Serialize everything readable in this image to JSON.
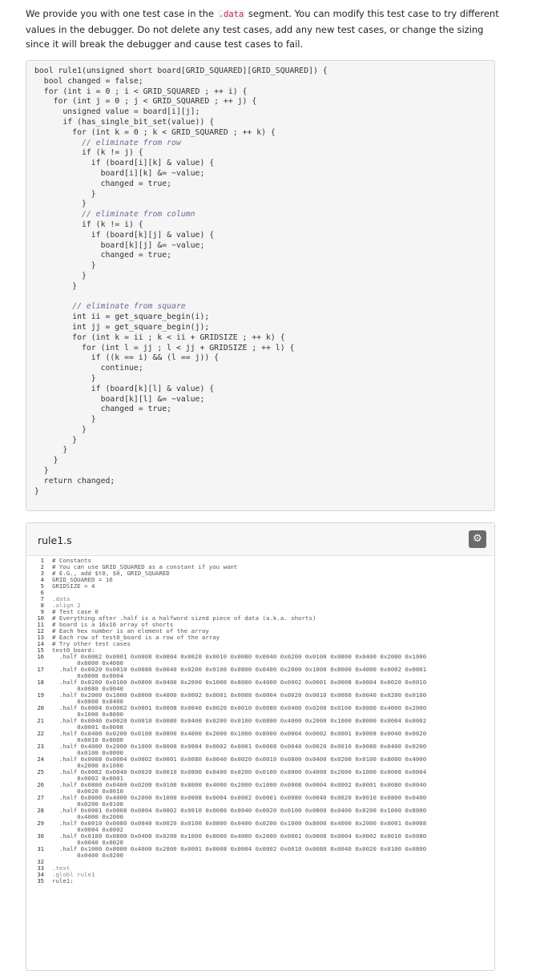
{
  "intro": {
    "before": "We provide you with one test case in the ",
    "data_word": ".data",
    "after": " segment. You can modify this test case to try different values in the debugger. Do not delete any test cases, add any new test cases, or change the sizing since it will break the debugger and cause test cases to fail."
  },
  "c_code": [
    "bool rule1(unsigned short board[GRID_SQUARED][GRID_SQUARED]) {",
    "  bool changed = false;",
    "  for (int i = 0 ; i < GRID_SQUARED ; ++ i) {",
    "    for (int j = 0 ; j < GRID_SQUARED ; ++ j) {",
    "      unsigned value = board[i][j];",
    "      if (has_single_bit_set(value)) {",
    "        for (int k = 0 ; k < GRID_SQUARED ; ++ k) {",
    "          // eliminate from row",
    "          if (k != j) {",
    "            if (board[i][k] & value) {",
    "              board[i][k] &= ~value;",
    "              changed = true;",
    "            }",
    "          }",
    "          // eliminate from column",
    "          if (k != i) {",
    "            if (board[k][j] & value) {",
    "              board[k][j] &= ~value;",
    "              changed = true;",
    "            }",
    "          }",
    "        }",
    "",
    "        // eliminate from square",
    "        int ii = get_square_begin(i);",
    "        int jj = get_square_begin(j);",
    "        for (int k = ii ; k < ii + GRIDSIZE ; ++ k) {",
    "          for (int l = jj ; l < jj + GRIDSIZE ; ++ l) {",
    "            if ((k == i) && (l == j)) {",
    "              continue;",
    "            }",
    "            if (board[k][l] & value) {",
    "              board[k][l] &= ~value;",
    "              changed = true;",
    "            }",
    "          }",
    "        }",
    "      }",
    "    }",
    "  }",
    "  return changed;",
    "}"
  ],
  "panel": {
    "title": "rule1.s",
    "settings_icon": "gear-icon"
  },
  "editor_lines": [
    {
      "n": "1",
      "t": "# Constants"
    },
    {
      "n": "2",
      "t": "# You can use GRID_SQUARED as a constant if you want"
    },
    {
      "n": "3",
      "t": "# E.G., add $t0, $0, GRID_SQUARED"
    },
    {
      "n": "4",
      "t": "GRID_SQUARED = 16"
    },
    {
      "n": "5",
      "t": "GRIDSIZE = 4"
    },
    {
      "n": "6",
      "t": ""
    },
    {
      "n": "7",
      "t": ".data"
    },
    {
      "n": "8",
      "t": ".align 2"
    },
    {
      "n": "9",
      "t": "# Test case 0"
    },
    {
      "n": "10",
      "t": "# Everything after .half is a halfword sized piece of data (a.k.a. shorts)"
    },
    {
      "n": "11",
      "t": "# board is a 16x16 array of shorts"
    },
    {
      "n": "12",
      "t": "# Each hex number is an element of the array"
    },
    {
      "n": "13",
      "t": "# Each row of test0_board is a row of the array"
    },
    {
      "n": "14",
      "t": "# Try other test cases"
    },
    {
      "n": "15",
      "t": "test0_board:"
    },
    {
      "n": "16",
      "t": "  .half 0x0002 0x0001 0x0008 0x0004 0x0020 0x0010 0x0080 0x0040 0x0200 0x0100 0x0800 0x0400 0x2000 0x1000\n       0x8000 0x4000"
    },
    {
      "n": "17",
      "t": "  .half 0x0020 0x0010 0x0080 0x0040 0x0200 0x0100 0x0800 0x0400 0x2000 0x1000 0x8000 0x4000 0x0002 0x0001\n       0x0008 0x0004"
    },
    {
      "n": "18",
      "t": "  .half 0x0200 0x0100 0x0800 0x0400 0x2000 0x1000 0x8000 0x4000 0x0002 0x0001 0x0008 0x0004 0x0020 0x0010\n       0x0080 0x0040"
    },
    {
      "n": "19",
      "t": "  .half 0x2000 0x1000 0x8000 0x4000 0x0002 0x0001 0x0008 0x0004 0x0020 0x0010 0x0080 0x0040 0x0200 0x0100\n       0x0800 0x0400"
    },
    {
      "n": "20",
      "t": "  .half 0x0004 0x0002 0x0001 0x0008 0x0040 0x0020 0x0010 0x0080 0x0400 0x0200 0x0100 0x0800 0x4000 0x2000\n       0x1000 0x8000"
    },
    {
      "n": "21",
      "t": "  .half 0x0040 0x0020 0x0010 0x0080 0x0400 0x0200 0x0100 0x0800 0x4000 0x2000 0x1000 0x8000 0x0004 0x0002\n       0x0001 0x0008"
    },
    {
      "n": "22",
      "t": "  .half 0x0400 0x0200 0x0100 0x0800 0x4000 0x2000 0x1000 0x8000 0x0004 0x0002 0x0001 0x0008 0x0040 0x0020\n       0x0010 0x0080"
    },
    {
      "n": "23",
      "t": "  .half 0x4000 0x2000 0x1000 0x8000 0x0004 0x0002 0x0001 0x0008 0x0040 0x0020 0x0010 0x0080 0x0400 0x0200\n       0x0100 0x0800"
    },
    {
      "n": "24",
      "t": "  .half 0x0008 0x0004 0x0002 0x0001 0x0080 0x0040 0x0020 0x0010 0x0800 0x0400 0x0200 0x0100 0x8000 0x4000\n       0x2000 0x1000"
    },
    {
      "n": "25",
      "t": "  .half 0x0082 0x0040 0x0020 0x0010 0x0800 0x0400 0x0200 0x0100 0x8000 0x4000 0x2000 0x1000 0x0008 0x0004\n       0x0002 0x0001"
    },
    {
      "n": "26",
      "t": "  .half 0x0800 0x0400 0x0200 0x0100 0x8000 0x4000 0x2000 0x1000 0x0008 0x0004 0x0002 0x0001 0x0080 0x0040\n       0x0020 0x0010"
    },
    {
      "n": "27",
      "t": "  .half 0x8000 0x4000 0x2000 0x1000 0x0008 0x0004 0x0002 0x0001 0x0080 0x0040 0x0020 0x0010 0x0800 0x0400\n       0x0200 0x0100"
    },
    {
      "n": "28",
      "t": "  .half 0x0001 0x0008 0x0004 0x0002 0x0010 0x0080 0x0040 0x0020 0x0100 0x0800 0x0400 0x0200 0x1000 0x8000\n       0x4000 0x2000"
    },
    {
      "n": "29",
      "t": "  .half 0x0010 0x0080 0x0040 0x0020 0x0100 0x0800 0x0400 0x0200 0x1000 0x8000 0x4000 0x2000 0x0001 0x0008\n       0x0004 0x0002"
    },
    {
      "n": "30",
      "t": "  .half 0x0100 0x0800 0x0400 0x0200 0x1000 0x8000 0x4000 0x2000 0x0001 0x0008 0x0004 0x0002 0x0010 0x0080\n       0x0040 0x0020"
    },
    {
      "n": "31",
      "t": "  .half 0x1000 0x8000 0x4000 0x2000 0x0001 0x0008 0x0004 0x0002 0x0010 0x0080 0x0040 0x0020 0x0100 0x0800\n       0x0400 0x0200"
    },
    {
      "n": "32",
      "t": ""
    },
    {
      "n": "33",
      "t": ".text"
    },
    {
      "n": "34",
      "t": ".globl rule1"
    },
    {
      "n": "35",
      "t": "rule1:"
    }
  ]
}
